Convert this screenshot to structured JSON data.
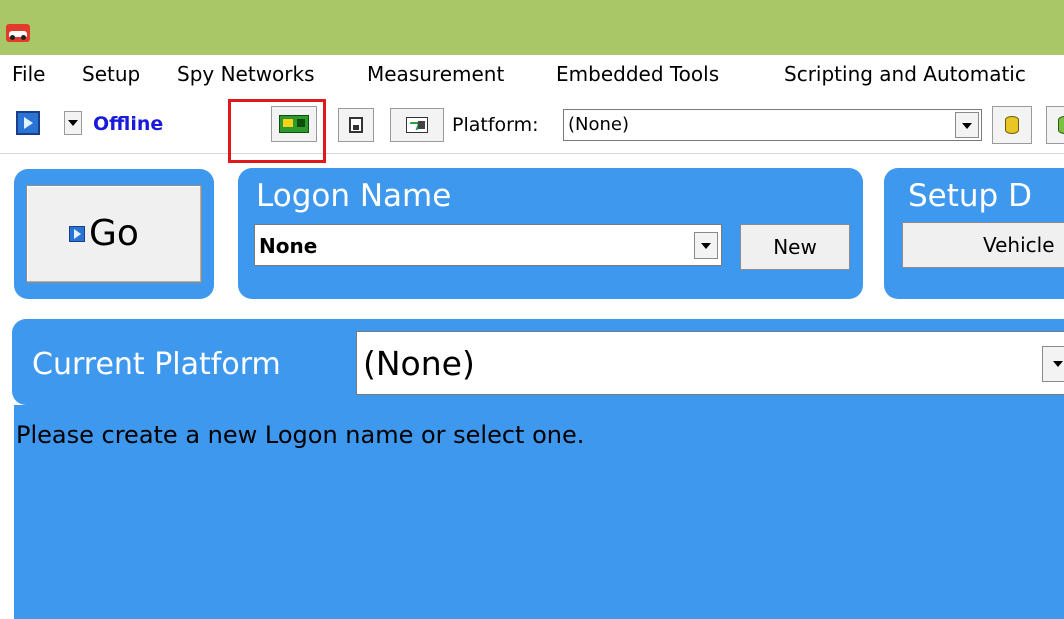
{
  "menu": {
    "items": [
      {
        "label": "File"
      },
      {
        "label": "Setup"
      },
      {
        "label": "Spy Networks"
      },
      {
        "label": "Measurement"
      },
      {
        "label": "Embedded Tools"
      },
      {
        "label": "Scripting and Automatic"
      }
    ]
  },
  "toolbar": {
    "status_label": "Offline",
    "platform_label": "Platform:",
    "platform_value": "(None)"
  },
  "go_panel": {
    "go_label": "Go"
  },
  "logon_panel": {
    "title": "Logon Name",
    "selected_value": "None",
    "new_button_label": "New"
  },
  "setup_panel": {
    "title": "Setup D",
    "vehicle_button_label": "Vehicle"
  },
  "current_platform": {
    "label": "Current Platform",
    "value": "(None)"
  },
  "message": {
    "text": "Please create a new Logon name or select one."
  },
  "colors": {
    "titlebar": "#a9c766",
    "panel_blue": "#3d98ee",
    "offline_text": "#1a1adb",
    "highlight": "#e0191e"
  }
}
